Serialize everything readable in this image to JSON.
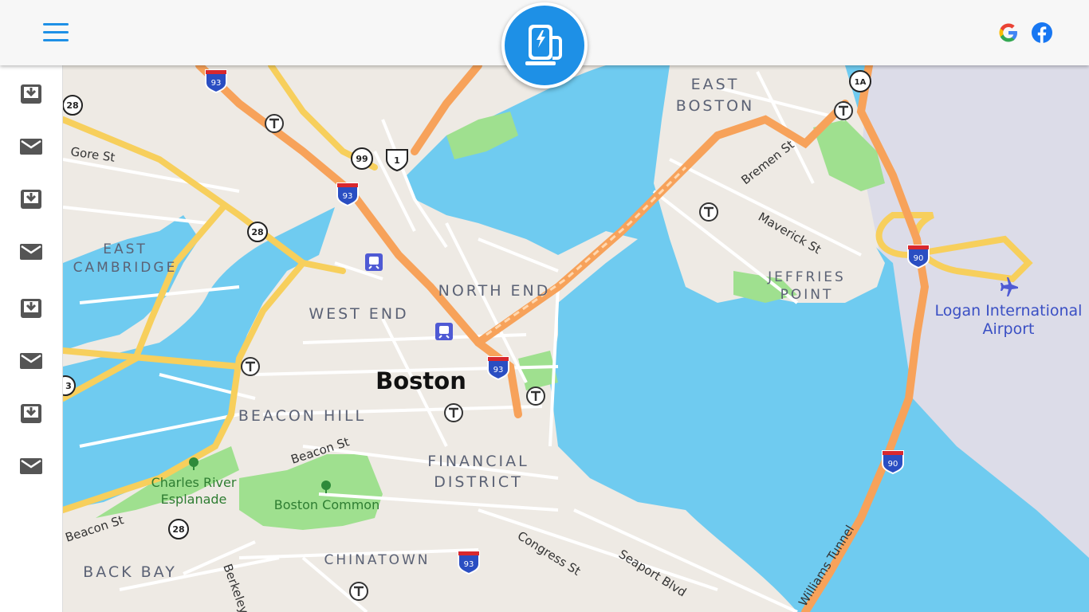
{
  "header": {
    "menu_icon": "hamburger-menu-icon",
    "logo_icon": "ev-charging-station-icon",
    "google_icon": "google-icon",
    "facebook_icon": "facebook-icon"
  },
  "sidebar": {
    "items": [
      {
        "icon": "download-icon"
      },
      {
        "icon": "mail-icon"
      },
      {
        "icon": "download-icon"
      },
      {
        "icon": "mail-icon"
      },
      {
        "icon": "download-icon"
      },
      {
        "icon": "mail-icon"
      },
      {
        "icon": "download-icon"
      },
      {
        "icon": "mail-icon"
      }
    ]
  },
  "map": {
    "city_label": "Boston",
    "neighborhoods": {
      "east_boston_1": "EAST",
      "east_boston_2": "BOSTON",
      "east_cambridge_1": "EAST",
      "east_cambridge_2": "CAMBRIDGE",
      "north_end": "NORTH END",
      "west_end": "WEST END",
      "jeffries_1": "JEFFRIES",
      "jeffries_2": "POINT",
      "beacon_hill": "BEACON HILL",
      "financial_1": "FINANCIAL",
      "financial_2": "DISTRICT",
      "back_bay": "BACK BAY",
      "chinatown": "CHINATOWN"
    },
    "streets": {
      "gore": "Gore St",
      "bremen": "Bremen St",
      "maverick": "Maverick St",
      "beacon_1": "Beacon St",
      "beacon_2": "Beacon St",
      "congress": "Congress St",
      "seaport": "Seaport Blvd",
      "williams": "Williams Tunnel",
      "berkeley": "Berkeley"
    },
    "places": {
      "airport_1": "Logan International",
      "airport_2": "Airport",
      "esplanade_1": "Charles River",
      "esplanade_2": "Esplanade",
      "common": "Boston Common"
    },
    "shields": {
      "i93": "93",
      "i90": "90",
      "r28": "28",
      "r99": "99",
      "us1": "1",
      "r1a": "1A",
      "r3": "3"
    },
    "colors": {
      "water": "#6fcbf0",
      "land": "#eeeae4",
      "park": "#9fe08f",
      "highway": "#f7a25a",
      "major_road": "#f7cf5c",
      "airport": "#dcdce8",
      "label": "#5b6275"
    }
  }
}
